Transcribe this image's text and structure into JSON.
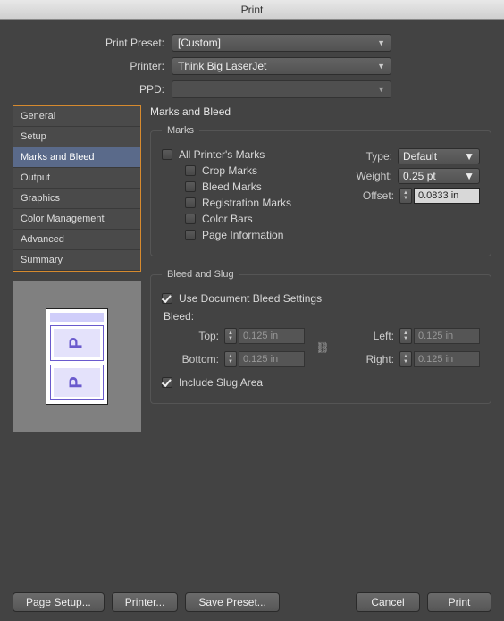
{
  "title": "Print",
  "form": {
    "preset_label": "Print Preset:",
    "preset_value": "[Custom]",
    "printer_label": "Printer:",
    "printer_value": "Think Big LaserJet",
    "ppd_label": "PPD:",
    "ppd_value": ""
  },
  "sidebar": {
    "items": [
      {
        "label": "General"
      },
      {
        "label": "Setup"
      },
      {
        "label": "Marks and Bleed"
      },
      {
        "label": "Output"
      },
      {
        "label": "Graphics"
      },
      {
        "label": "Color Management"
      },
      {
        "label": "Advanced"
      },
      {
        "label": "Summary"
      }
    ],
    "selected_index": 2
  },
  "panel_title": "Marks and Bleed",
  "marks": {
    "legend": "Marks",
    "all_label": "All Printer's Marks",
    "crop_label": "Crop Marks",
    "bleed_label": "Bleed Marks",
    "reg_label": "Registration Marks",
    "color_label": "Color Bars",
    "pageinfo_label": "Page Information",
    "type_label": "Type:",
    "type_value": "Default",
    "weight_label": "Weight:",
    "weight_value": "0.25 pt",
    "offset_label": "Offset:",
    "offset_value": "0.0833 in"
  },
  "bleed": {
    "legend": "Bleed and Slug",
    "use_doc_label": "Use Document Bleed Settings",
    "bleed_label": "Bleed:",
    "top_label": "Top:",
    "top_value": "0.125 in",
    "bottom_label": "Bottom:",
    "bottom_value": "0.125 in",
    "left_label": "Left:",
    "left_value": "0.125 in",
    "right_label": "Right:",
    "right_value": "0.125 in",
    "slug_label": "Include Slug Area"
  },
  "buttons": {
    "page_setup": "Page Setup...",
    "printer": "Printer...",
    "save_preset": "Save Preset...",
    "cancel": "Cancel",
    "print": "Print"
  },
  "preview_letter": "P"
}
